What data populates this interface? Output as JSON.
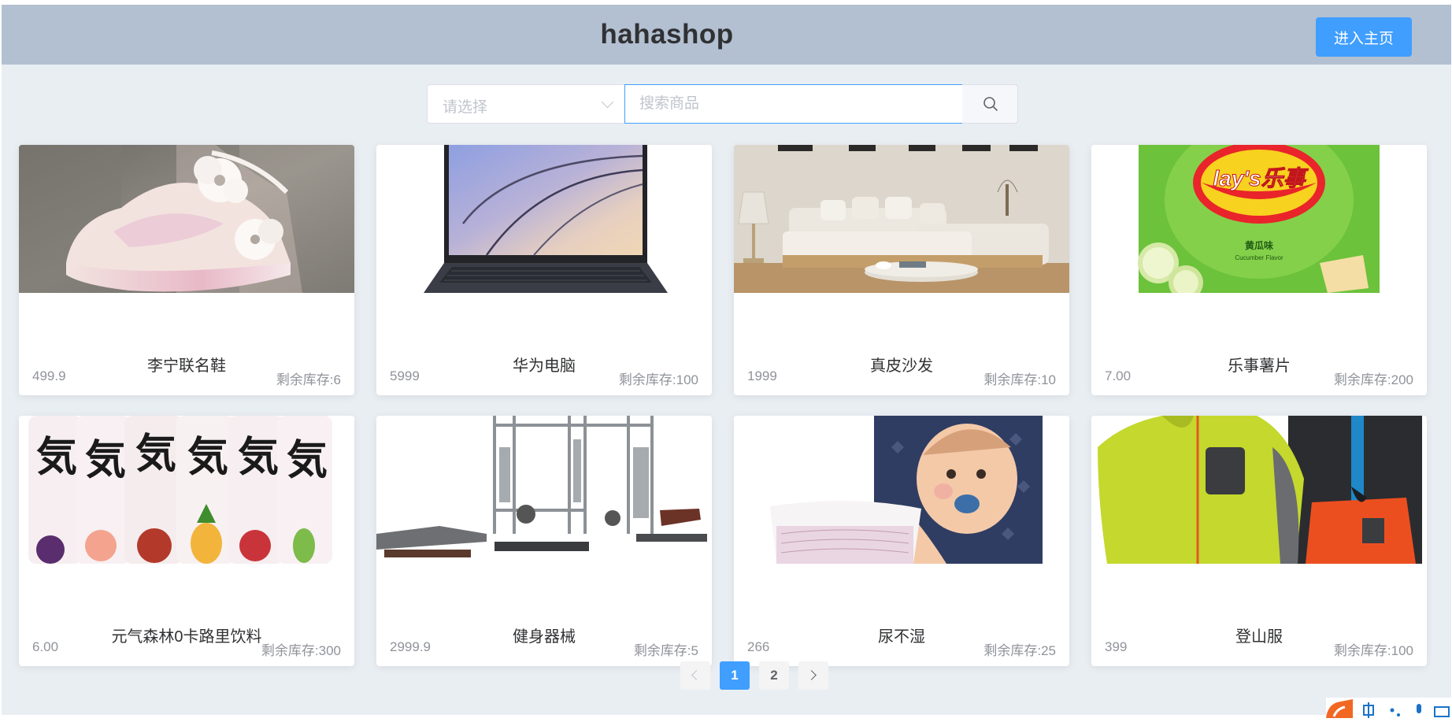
{
  "header": {
    "title": "hahashop",
    "home_button": "进入主页"
  },
  "search": {
    "category_placeholder": "请选择",
    "keyword_placeholder": "搜索商品"
  },
  "products": [
    {
      "name": "李宁联名鞋",
      "price": "499.9",
      "stock": "剩余库存:6"
    },
    {
      "name": "华为电脑",
      "price": "5999",
      "stock": "剩余库存:100"
    },
    {
      "name": "真皮沙发",
      "price": "1999",
      "stock": "剩余库存:10"
    },
    {
      "name": "乐事薯片",
      "price": "7.00",
      "stock": "剩余库存:200"
    },
    {
      "name": "元气森林0卡路里饮料",
      "price": "6.00",
      "stock": "剩余库存:300"
    },
    {
      "name": "健身器械",
      "price": "2999.9",
      "stock": "剩余库存:5"
    },
    {
      "name": "尿不湿",
      "price": "266",
      "stock": "剩余库存:25"
    },
    {
      "name": "登山服",
      "price": "399",
      "stock": "剩余库存:100"
    }
  ],
  "product_images": {
    "lays_logo": "lay's乐事",
    "lays_flavor": "黄瓜味",
    "lays_flavor_en": "Cucumber Flavor",
    "drink_logo": "気"
  },
  "pagination": {
    "pages": [
      "1",
      "2"
    ],
    "current": "1"
  },
  "colors": {
    "primary": "#409eff",
    "header_bg": "#b3c0d1",
    "page_bg": "#e9eef3"
  },
  "icons": {
    "search": "search-icon",
    "prev": "chevron-left-icon",
    "next": "chevron-right-icon",
    "dropdown": "chevron-down-icon"
  }
}
